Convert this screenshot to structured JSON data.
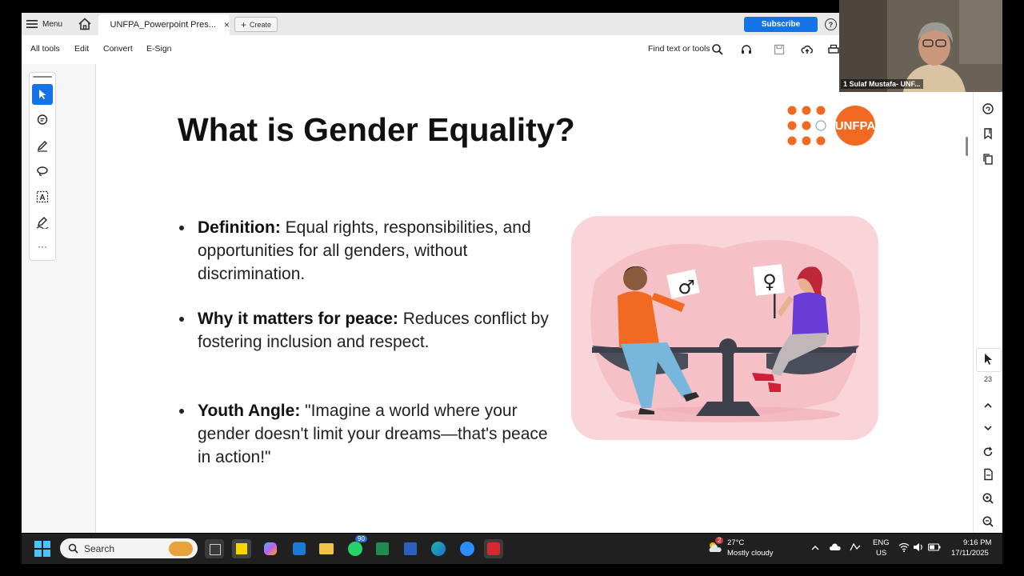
{
  "tabbar": {
    "menu_label": "Menu",
    "doc_tab_title": "UNFPA_Powerpoint Pres...",
    "close_glyph": "×",
    "create_label": "Create",
    "subscribe_label": "Subscribe",
    "help_glyph": "?"
  },
  "toolbar": {
    "items": [
      "All tools",
      "Edit",
      "Convert",
      "E-Sign"
    ],
    "find_label": "Find text or tools"
  },
  "rail": {
    "tools": [
      "select-icon",
      "comment-icon",
      "highlight-icon",
      "lasso-icon",
      "text-select-icon",
      "sign-icon"
    ],
    "more_glyph": "···"
  },
  "slide": {
    "title": "What is Gender Equality?",
    "logo_text": "UNFPA",
    "bullets": [
      {
        "heading": "Definition:",
        "text": " Equal rights, responsibilities, and opportunities for all genders, without discrimination."
      },
      {
        "heading": "Why it matters for peace:",
        "text": " Reduces conflict by fostering inclusion and respect."
      },
      {
        "heading": "Youth Angle:",
        "text": " \"Imagine a world where your gender doesn't limit your dreams—that's peace in action!\""
      }
    ],
    "male_symbol": "♂",
    "female_symbol": "♀"
  },
  "right_sidebar": {
    "page_number": "23"
  },
  "webcam": {
    "participant_name": "1 Sulaf Mustafa- UNF..."
  },
  "taskbar": {
    "search_placeholder": "Search",
    "whatsapp_badge": "90",
    "weather_badge": "2",
    "temperature": "27°C",
    "weather": "Mostly cloudy",
    "language": "ENG",
    "region": "US",
    "time": "9:16 PM",
    "date": "17/11/2025"
  },
  "colors": {
    "accent": "#1473e6",
    "unfpa_orange": "#f26a21",
    "illustration_bg": "#f7c9cf"
  }
}
